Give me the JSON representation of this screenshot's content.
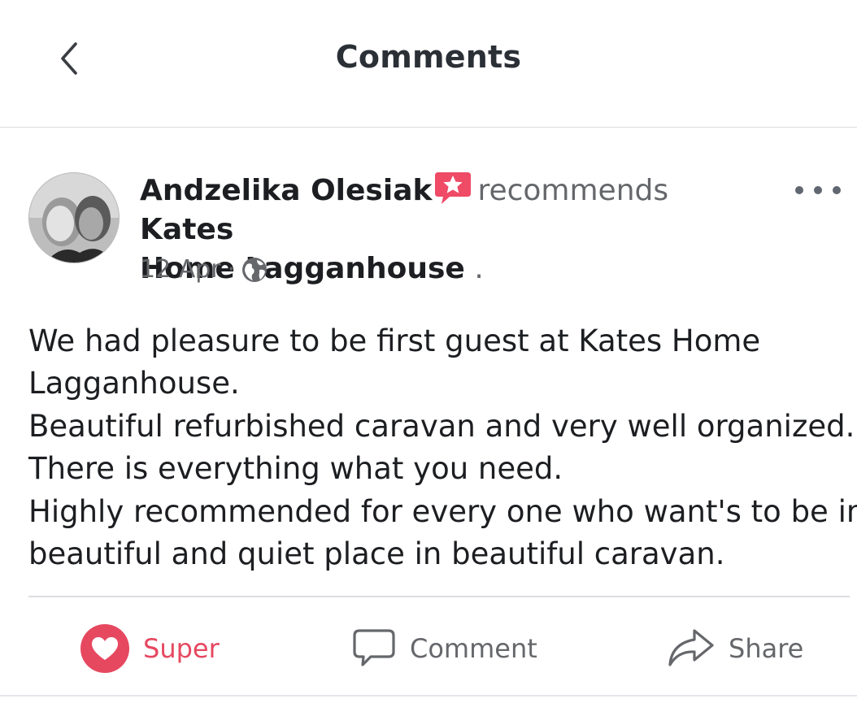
{
  "header": {
    "title": "Comments"
  },
  "post": {
    "author": "Andzelika Olesiak",
    "action": "recommends",
    "page_name_line1": "Kates",
    "page_name_line2": "Home Lagganhouse",
    "trailing": ".",
    "date": "12 Apr",
    "separator": "·",
    "body_lines": [
      "We had pleasure to be first guest at Kates Home",
      "Lagganhouse.",
      "Beautiful refurbished caravan and very well organized.",
      "There is everything what you need.",
      "Highly recommended for every one who want's to be in",
      "beautiful and quiet place in beautiful caravan."
    ]
  },
  "actions": {
    "super_label": "Super",
    "comment_label": "Comment",
    "share_label": "Share"
  },
  "colors": {
    "reaction": "#e64860",
    "text": "#1c1e21",
    "muted": "#65676b"
  },
  "icons": {
    "back": "chevron-left-icon",
    "badge": "recommendation-star-icon",
    "privacy": "globe-icon",
    "more": "more-horizontal-icon",
    "super": "heart-icon",
    "comment": "comment-bubble-icon",
    "share": "share-arrow-icon"
  }
}
